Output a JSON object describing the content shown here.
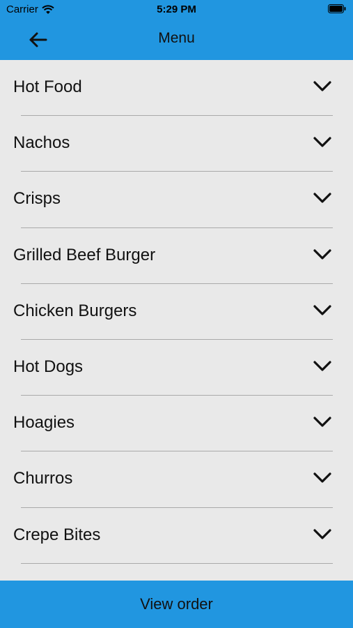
{
  "status_bar": {
    "carrier": "Carrier",
    "time": "5:29 PM",
    "wifi_icon": "wifi-icon",
    "battery_icon": "battery-icon"
  },
  "header": {
    "title": "Menu",
    "back_icon": "arrow-left-icon",
    "background": "#2196e0"
  },
  "menu": {
    "items": [
      {
        "label": "Hot Food"
      },
      {
        "label": "Nachos"
      },
      {
        "label": "Crisps"
      },
      {
        "label": "Grilled Beef Burger"
      },
      {
        "label": "Chicken Burgers"
      },
      {
        "label": "Hot Dogs"
      },
      {
        "label": "Hoagies"
      },
      {
        "label": "Churros"
      },
      {
        "label": "Crepe Bites"
      }
    ],
    "expand_icon": "chevron-down-icon"
  },
  "footer": {
    "button_label": "View order",
    "background": "#2196e0"
  }
}
